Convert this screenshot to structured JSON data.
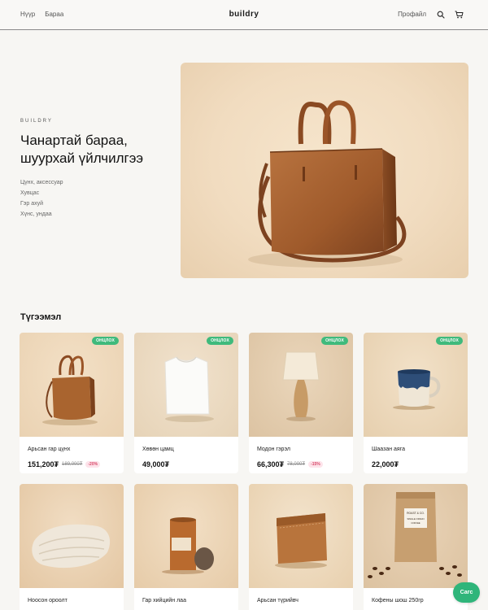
{
  "header": {
    "nav": [
      "Нүүр",
      "Бараа"
    ],
    "logo": "buildry",
    "profile": "Профайл",
    "icons": [
      "search-icon",
      "cart-icon"
    ]
  },
  "hero": {
    "eyebrow": "BUILDRY",
    "title_line1": "Чанартай бараа,",
    "title_line2": "шуурхай үйлчилгээ",
    "categories": [
      "Цүнх, аксессуар",
      "Хувцас",
      "Гэр ахуй",
      "Хүнс, ундаа"
    ]
  },
  "section": {
    "title": "Түгээмэл"
  },
  "products": [
    {
      "name": "Арьсан гар цүнх",
      "price": "151,200₮",
      "old_price": "189,000₮",
      "discount": "-20%",
      "badge": "ОНЦЛОХ"
    },
    {
      "name": "Хөвөн цамц",
      "price": "49,000₮",
      "old_price": "",
      "discount": "",
      "badge": "ОНЦЛОХ"
    },
    {
      "name": "Модон гэрэл",
      "price": "66,300₮",
      "old_price": "78,000₮",
      "discount": "-15%",
      "badge": "ОНЦЛОХ"
    },
    {
      "name": "Шаазан аяга",
      "price": "22,000₮",
      "old_price": "",
      "discount": "",
      "badge": "ОНЦЛОХ"
    },
    {
      "name": "Ноосон ороолт",
      "price": "",
      "old_price": "",
      "discount": "",
      "badge": ""
    },
    {
      "name": "Гар хийцийн лаа",
      "price": "",
      "old_price": "",
      "discount": "",
      "badge": ""
    },
    {
      "name": "Арьсан түрийвч",
      "price": "",
      "old_price": "",
      "discount": "",
      "badge": ""
    },
    {
      "name": "Кофены шош 250гр",
      "price": "",
      "old_price": "",
      "discount": "",
      "badge": ""
    }
  ],
  "coffee_label": {
    "line1": "ROAST & CO.",
    "line2": "SINGLE ORIGIN",
    "line3": "COFFEE"
  },
  "chat": {
    "label": "Сагс"
  },
  "colors": {
    "accent": "#3fba7c",
    "discount": "#d84a6b",
    "card_bg": "#ffffff",
    "page_bg": "#f7f6f3"
  }
}
